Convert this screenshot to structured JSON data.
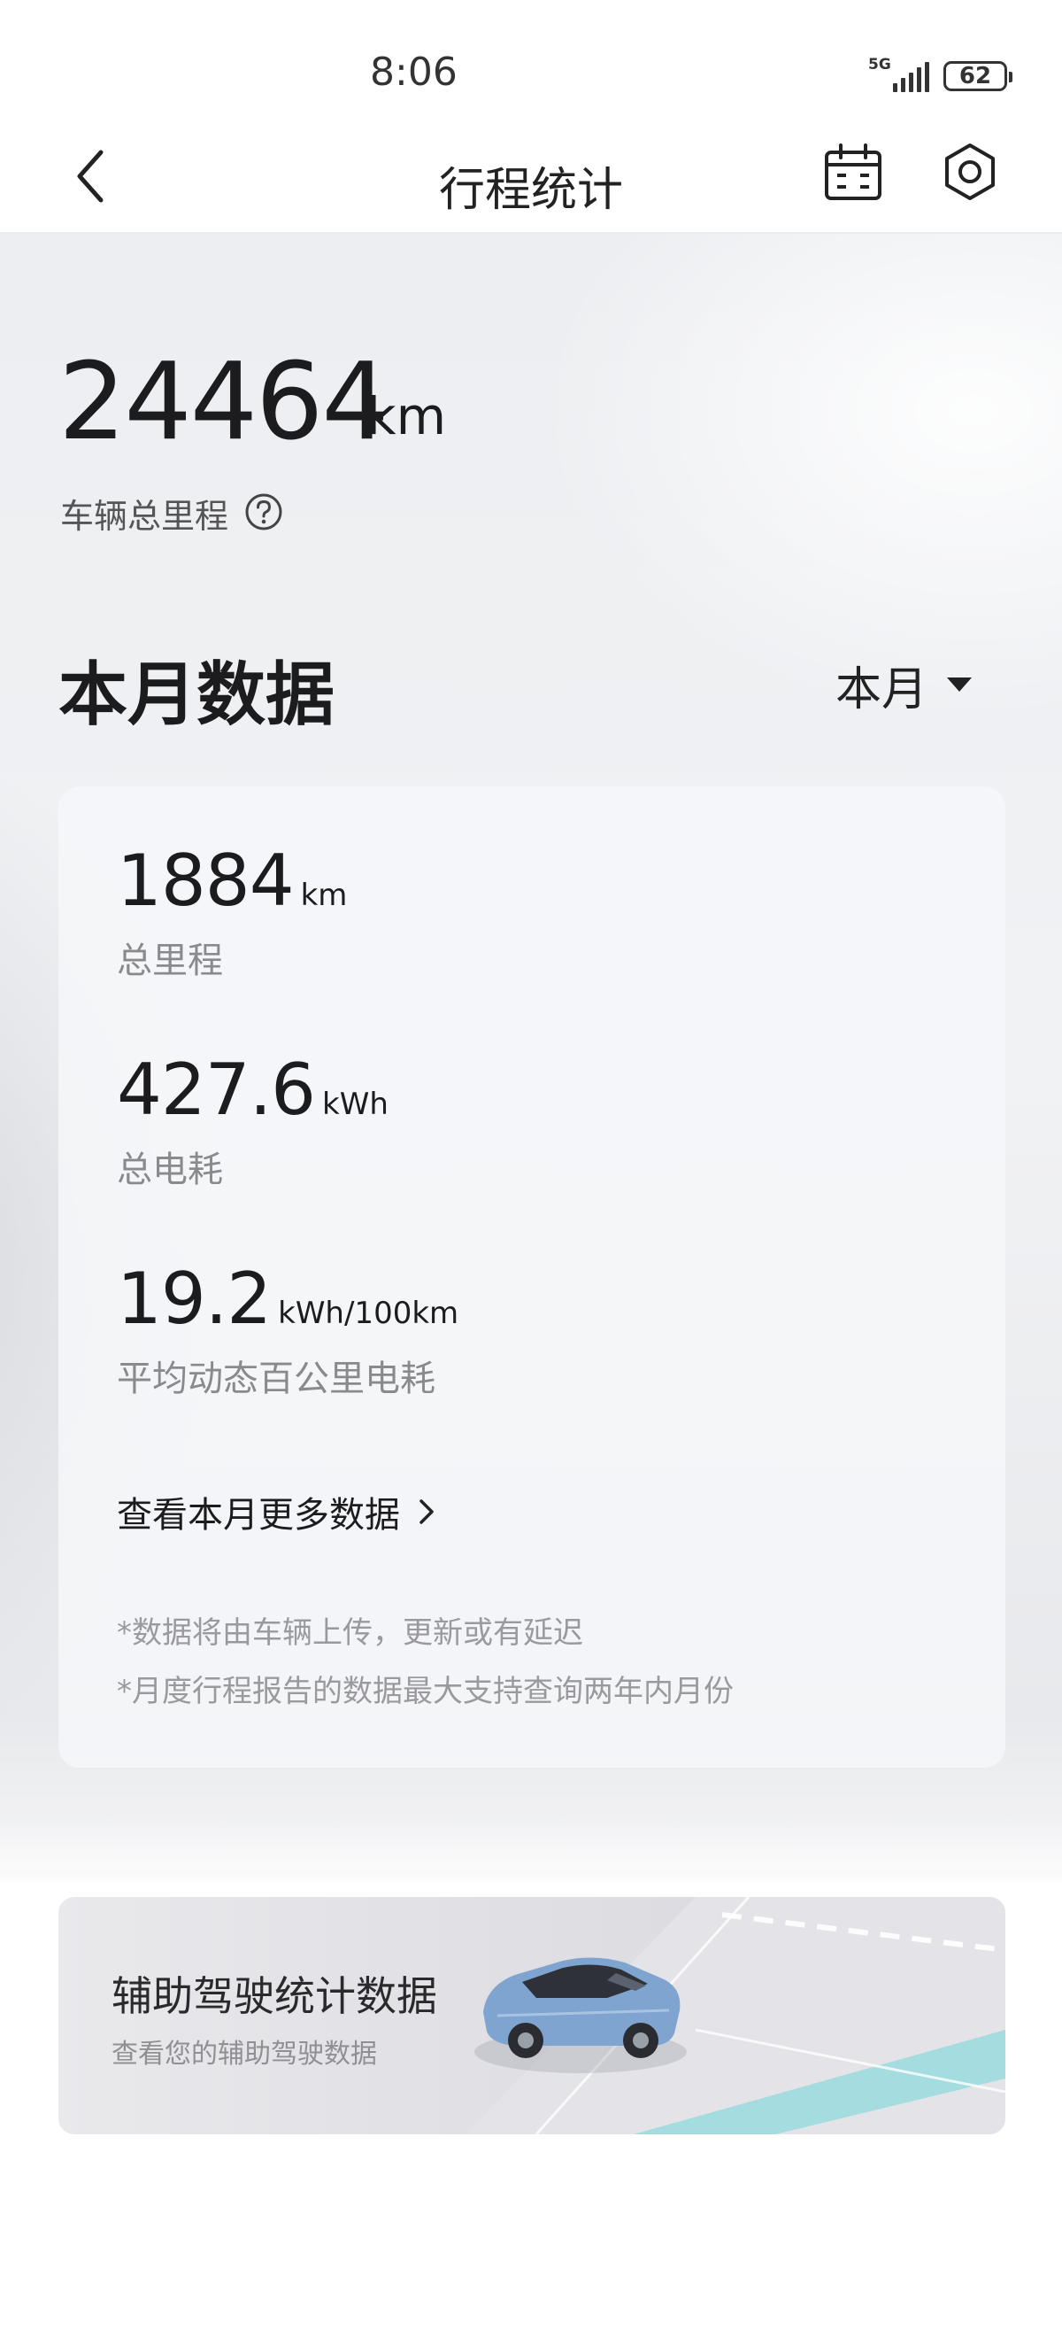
{
  "status_bar": {
    "time": "8:06",
    "network": "5G",
    "battery": "62"
  },
  "header": {
    "title": "行程统计"
  },
  "total": {
    "value": "24464",
    "unit": "km",
    "label": "车辆总里程"
  },
  "month": {
    "title": "本月数据",
    "period_selected": "本月",
    "stats": [
      {
        "value": "1884",
        "unit": "km",
        "label": "总里程"
      },
      {
        "value": "427.6",
        "unit": "kWh",
        "label": "总电耗"
      },
      {
        "value": "19.2",
        "unit": "kWh/100km",
        "label": "平均动态百公里电耗"
      }
    ],
    "more_link": "查看本月更多数据",
    "notes": [
      "*数据将由车辆上传，更新或有延迟",
      "*月度行程报告的数据最大支持查询两年内月份"
    ]
  },
  "assist": {
    "title": "辅助驾驶统计数据",
    "subtitle": "查看您的辅助驾驶数据"
  },
  "colors": {
    "primary_text": "#1c1c1e",
    "secondary_text": "#8a8a8e",
    "car_blue": "#7ea4cf",
    "lane_teal": "#8fd9dc"
  }
}
